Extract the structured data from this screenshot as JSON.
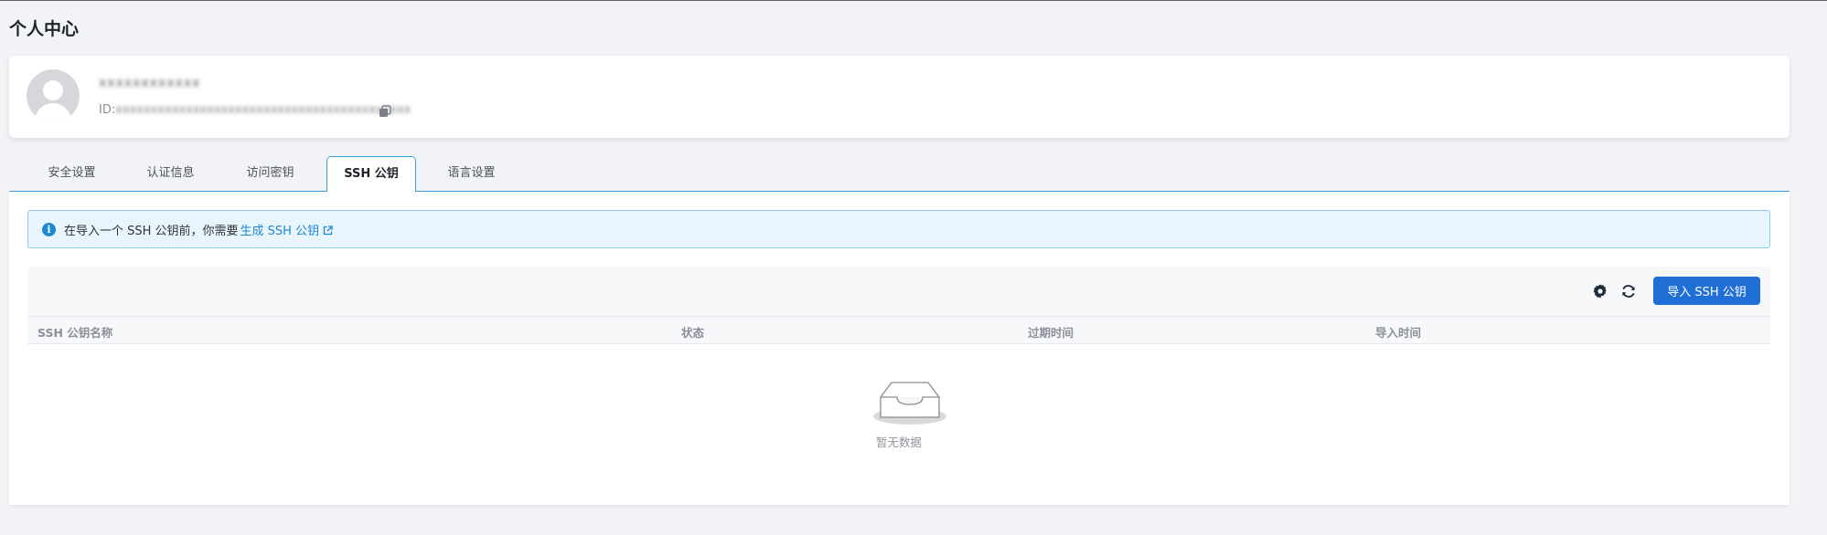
{
  "page": {
    "title": "个人中心"
  },
  "profile": {
    "username": "xxxxxxxxxxxx",
    "id_label": "ID:",
    "id_value": "xxxxxxxxxxxxxxxxxxxxxxxxxxxxxxxxxxxxxxxxxx"
  },
  "tabs": [
    {
      "label": "安全设置",
      "active": false
    },
    {
      "label": "认证信息",
      "active": false
    },
    {
      "label": "访问密钥",
      "active": false
    },
    {
      "label": "SSH 公钥",
      "active": true
    },
    {
      "label": "语言设置",
      "active": false
    }
  ],
  "alert": {
    "text": "在导入一个 SSH 公钥前，你需要",
    "link": "生成 SSH 公钥"
  },
  "toolbar": {
    "settings_icon": "gear-icon",
    "refresh_icon": "refresh-icon",
    "import_label": "导入 SSH 公钥"
  },
  "table": {
    "columns": [
      "SSH 公钥名称",
      "状态",
      "过期时间",
      "导入时间"
    ],
    "rows": []
  },
  "empty": {
    "text": "暂无数据"
  },
  "colors": {
    "accent": "#1f6fd6",
    "link": "#1e88d2",
    "tab_border": "#3fa0d8",
    "alert_bg": "#e9f5fc",
    "page_bg": "#f1f3f6"
  }
}
